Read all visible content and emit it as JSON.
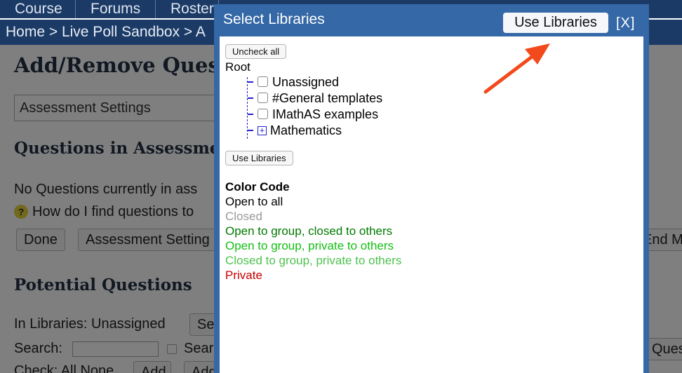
{
  "nav": {
    "tabs": [
      "Course",
      "Forums",
      "Roster"
    ]
  },
  "breadcrumb": "Home > Live Poll Sandbox > A",
  "page": {
    "title": "Add/Remove Quest",
    "settings_box": "Assessment Settings",
    "questions_heading": "Questions in Assessme",
    "no_questions": "No Questions currently in ass",
    "help_text": "How do I find questions to",
    "help_icon": "?",
    "buttons": {
      "done": "Done",
      "assessment_settings": "Assessment Setting",
      "end": "End M"
    },
    "potential_heading": "Potential Questions",
    "in_libraries": "In Libraries: Unassigned",
    "select_btn": "Se",
    "search_label": "Search:",
    "search_check_label": "Sear",
    "ques_btn": "Ques",
    "check_row": "Check: All None",
    "add_btn": "Add",
    "add_btn2": "Add"
  },
  "dialog": {
    "title": "Select Libraries",
    "use_libraries_top": "Use Libraries",
    "close": "[X]",
    "uncheck_all": "Uncheck all",
    "root": "Root",
    "tree": [
      {
        "label": "Unassigned",
        "type": "checkbox"
      },
      {
        "label": "#General templates",
        "type": "checkbox"
      },
      {
        "label": "IMathAS examples",
        "type": "checkbox"
      },
      {
        "label": "Mathematics",
        "type": "expand"
      }
    ],
    "expand_symbol": "+",
    "use_libraries_bottom": "Use Libraries",
    "color_code_heading": "Color Code",
    "legend": [
      {
        "label": "Open to all",
        "color": "#000000"
      },
      {
        "label": "Closed",
        "color": "#9a9a9a"
      },
      {
        "label": "Open to group, closed to others",
        "color": "#007a00"
      },
      {
        "label": "Open to group, private to others",
        "color": "#13bf13"
      },
      {
        "label": "Closed to group, private to others",
        "color": "#4fc24f"
      },
      {
        "label": "Private",
        "color": "#c80000"
      }
    ]
  },
  "annotation": {
    "arrow_color": "#f24a1c"
  }
}
